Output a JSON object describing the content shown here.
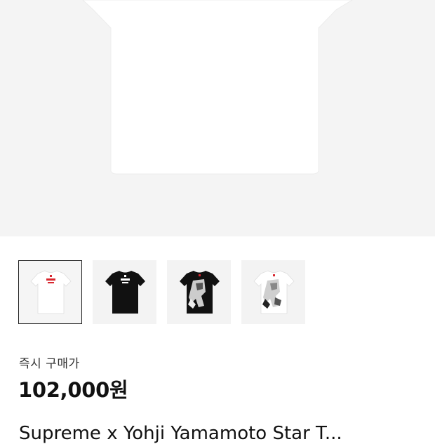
{
  "product": {
    "thumbnails": [
      {
        "name": "white-tshirt-red-logo",
        "shirt_color": "#ffffff",
        "selected": true
      },
      {
        "name": "black-tshirt-white-logo",
        "shirt_color": "#111111",
        "selected": false
      },
      {
        "name": "black-tshirt-graphic",
        "shirt_color": "#111111",
        "selected": false
      },
      {
        "name": "white-tshirt-graphic",
        "shirt_color": "#ffffff",
        "selected": false
      }
    ],
    "price_label": "즉시 구매가",
    "price": "102,000원",
    "title": "Supreme x Yohji Yamamoto Star T..."
  },
  "colors": {
    "hero_bg": "#f4f4f4",
    "thumb_bg": "#f3f3f3",
    "logo_red": "#d8262e"
  }
}
